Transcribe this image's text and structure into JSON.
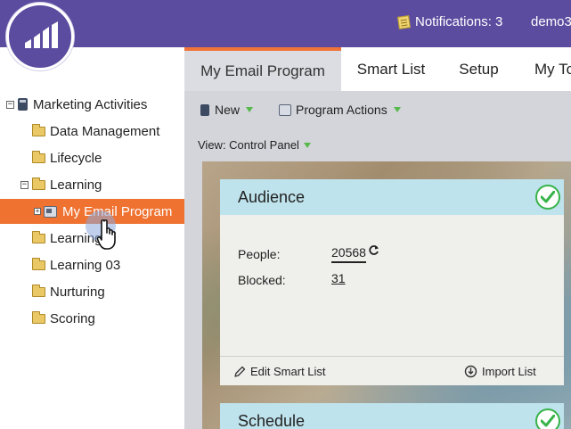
{
  "header": {
    "notifications_label": "Notifications: 3",
    "user_label": "demo3",
    "accent_color": "#5b4c9f"
  },
  "tabs": [
    {
      "label": "My Email Program",
      "active": true
    },
    {
      "label": "Smart List",
      "active": false
    },
    {
      "label": "Setup",
      "active": false
    },
    {
      "label": "My To",
      "active": false
    }
  ],
  "sidebar": {
    "root": "Marketing Activities",
    "items": [
      {
        "label": "Data Management"
      },
      {
        "label": "Lifecycle"
      },
      {
        "label": "Learning"
      },
      {
        "label": "My Email Program"
      },
      {
        "label": "Learning"
      },
      {
        "label": "Learning 03"
      },
      {
        "label": "Nurturing"
      },
      {
        "label": "Scoring"
      }
    ]
  },
  "toolbar": {
    "new_label": "New",
    "program_actions_label": "Program Actions"
  },
  "view": {
    "label": "View: Control Panel"
  },
  "audience_card": {
    "title": "Audience",
    "people_label": "People:",
    "people_value": "20568",
    "blocked_label": "Blocked:",
    "blocked_value": "31",
    "edit_smart_list_label": "Edit Smart List",
    "import_list_label": "Import List"
  },
  "schedule_card": {
    "title": "Schedule"
  },
  "colors": {
    "selected_row": "#ef7230",
    "tab_active_border": "#f0733a",
    "card_header": "#bfe3ec",
    "check_green": "#38b34a"
  }
}
